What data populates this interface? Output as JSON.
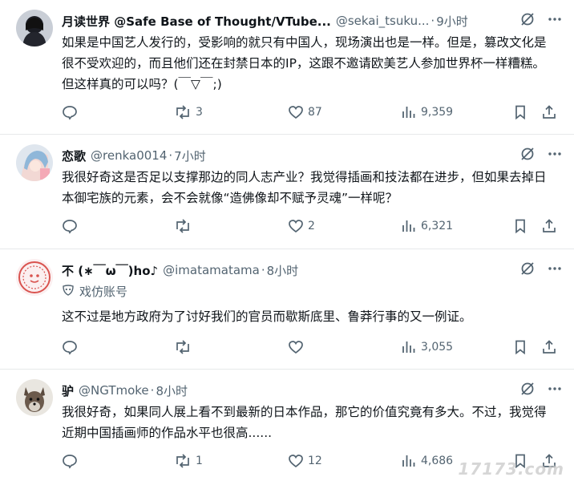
{
  "tweets": [
    {
      "name": "月读世界 @Safe Base of Thought/VTube...",
      "handle": "@sekai_tsuku...",
      "time": "9小时",
      "text": "如果是中国艺人发行的，受影响的就只有中国人，现场演出也是一样。但是，篡改文化是很不受欢迎的，而且他们还在封禁日本的IP，这跟不邀请欧美艺人参加世界杯一样糟糕。但这样真的可以吗？(￣▽￣;)",
      "replies": "",
      "retweets": "3",
      "likes": "87",
      "views": "9,359"
    },
    {
      "name": "恋歌",
      "handle": "@renka0014",
      "time": "7小时",
      "text": "我很好奇这是否足以支撑那边的同人志产业？我觉得插画和技法都在进步，但如果去掉日本御宅族的元素，会不会就像“造佛像却不赋予灵魂”一样呢？",
      "replies": "",
      "retweets": "",
      "likes": "2",
      "views": "6,321"
    },
    {
      "name": "不 (∗￣ω￣)ho♪",
      "handle": "@imatamatama",
      "time": "8小时",
      "parody_label": "戏仿账号",
      "text": "这不过是地方政府为了讨好我们的官员而歇斯底里、鲁莽行事的又一例证。",
      "replies": "",
      "retweets": "",
      "likes": "",
      "views": "3,055"
    },
    {
      "name": "驴",
      "handle": "@NGTmoke",
      "time": "8小时",
      "text": "我很好奇，如果同人展上看不到最新的日本作品，那它的价值究竟有多大。不过，我觉得近期中国插画师的作品水平也很高......",
      "replies": "",
      "retweets": "1",
      "likes": "12",
      "views": "4,686"
    }
  ],
  "icons": {
    "reply": "reply-icon",
    "retweet": "retweet-icon",
    "like": "heart-icon",
    "views": "views-icon",
    "bookmark": "bookmark-icon",
    "share": "share-icon",
    "grok": "grok-icon",
    "more": "more-icon"
  },
  "colors": {
    "text": "#0f1419",
    "secondary": "#536471",
    "divider": "#e7e9ea"
  },
  "watermark": "17173.com"
}
